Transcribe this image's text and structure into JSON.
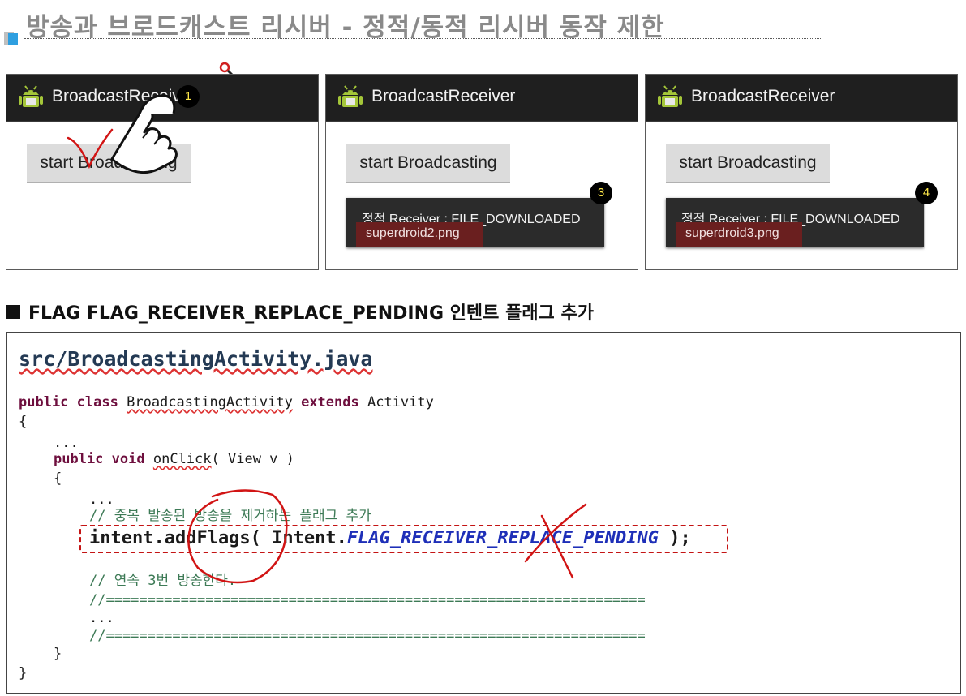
{
  "slide": {
    "title": "방송과 브로드캐스트 리시버 - 정적/동적 리시버 동작 제한"
  },
  "phones": [
    {
      "app_title": "BroadcastReceiver",
      "button_label": "start Broadcasting",
      "badge": "1"
    },
    {
      "app_title": "BroadcastReceiver",
      "button_label": "start Broadcasting",
      "badge": "3",
      "toast_line1": "정적 Receiver : FILE_DOWNLOADED",
      "toast_line2": "superdroid2.png"
    },
    {
      "app_title": "BroadcastReceiver",
      "button_label": "start Broadcasting",
      "badge": "4",
      "toast_line1": "정적 Receiver : FILE_DOWNLOADED",
      "toast_line2": "superdroid3.png"
    }
  ],
  "section": {
    "heading": "FLAG FLAG_RECEIVER_REPLACE_PENDING 인텐트 플래그 추가"
  },
  "code": {
    "filename": "src/BroadcastingActivity.java",
    "l1_kw1": "public",
    "l1_kw2": "class",
    "l1_name": "BroadcastingActivity",
    "l1_kw3": "extends",
    "l1_parent": "Activity",
    "l2": "{",
    "l3": "...",
    "l4_kw1": "public",
    "l4_kw2": "void",
    "l4_method": "onClick",
    "l4_rest": "( View v )",
    "l5": "{",
    "l6": "...",
    "l7_comment": "// 중복 발송된 방송을 제거하는 플래그 추가",
    "l8_pre": "intent.addFlags( Intent.",
    "l8_flag": "FLAG_RECEIVER_REPLACE_PENDING",
    "l8_post": " );",
    "l9_comment": "// 연속 3번 방송한다.",
    "l10_comment": "//=================================================================",
    "l11": "...",
    "l12_comment": "//=================================================================",
    "l13": "}",
    "l14": "}"
  },
  "colors": {
    "keyword": "#6e0f3e",
    "comment": "#3d7a56",
    "field": "#1e2fb8",
    "annotation": "#d11414",
    "toast_highlight": "#6a1f1f",
    "badge_text": "#ffe94a"
  },
  "icons": [
    "android-icon",
    "hand-cursor-icon",
    "check-mark-icon",
    "magnifier-cursor-icon"
  ]
}
